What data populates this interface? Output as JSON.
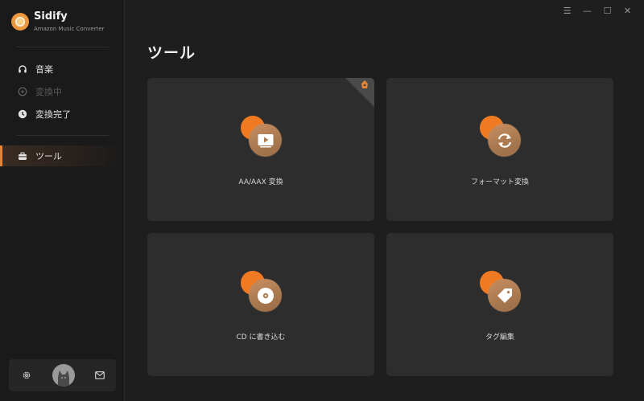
{
  "brand": {
    "name": "Sidify",
    "subtitle": "Amazon Music Converter"
  },
  "sidebar": {
    "items": [
      {
        "label": "音楽",
        "icon": "headphones-icon",
        "state": "normal"
      },
      {
        "label": "変換中",
        "icon": "converting-icon",
        "state": "disabled"
      },
      {
        "label": "変換完了",
        "icon": "clock-icon",
        "state": "normal"
      },
      {
        "label": "ツール",
        "icon": "toolbox-icon",
        "state": "active"
      }
    ],
    "bottom": {
      "settings_icon": "gear-icon",
      "avatar_icon": "avatar-icon",
      "mail_icon": "mail-icon"
    }
  },
  "titlebar": {
    "menu": "☰",
    "minimize": "—",
    "maximize": "☐",
    "close": "✕"
  },
  "page": {
    "title": "ツール"
  },
  "tools": [
    {
      "label": "AA/AAX 変換",
      "icon": "video-play-icon",
      "badge": "premium-badge-icon"
    },
    {
      "label": "フォーマット変換",
      "icon": "refresh-icon"
    },
    {
      "label": "CD に書き込む",
      "icon": "cd-icon"
    },
    {
      "label": "タグ編集",
      "icon": "tag-icon"
    }
  ],
  "colors": {
    "accent": "#ef7a22",
    "background": "#1e1e1e",
    "card": "#2d2d2d",
    "sidebar": "#1a1a1a"
  }
}
